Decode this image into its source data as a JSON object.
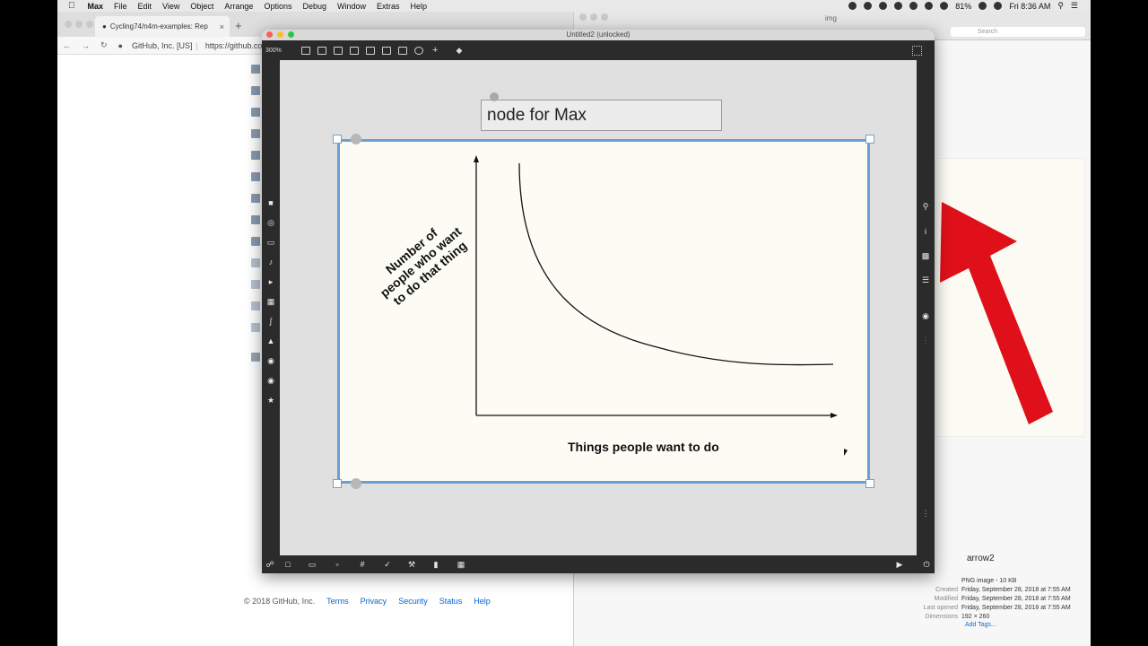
{
  "menubar": {
    "app": "Max",
    "items": [
      "File",
      "Edit",
      "View",
      "Object",
      "Arrange",
      "Options",
      "Debug",
      "Window",
      "Extras",
      "Help"
    ],
    "battery": "81%",
    "clock": "Fri 8:36 AM"
  },
  "browser": {
    "tab_title": "Cycling74/n4m-examples: Rep",
    "site_name": "GitHub, Inc. [US]",
    "url": "https://github.co",
    "footer": {
      "copyright": "© 2018 GitHub, Inc.",
      "links": [
        "Terms",
        "Privacy",
        "Security",
        "Status",
        "Help"
      ]
    }
  },
  "finder": {
    "folder": "img",
    "search_placeholder": "Search",
    "file_name": "arrow2",
    "file_kind": "PNG image - 10 KB",
    "meta": [
      {
        "k": "Created",
        "v": "Friday, September 28, 2018 at 7:55 AM"
      },
      {
        "k": "Modified",
        "v": "Friday, September 28, 2018 at 7:55 AM"
      },
      {
        "k": "Last opened",
        "v": "Friday, September 28, 2018 at 7:55 AM"
      },
      {
        "k": "Dimensions",
        "v": "192 × 260"
      }
    ],
    "add_tags": "Add Tags..."
  },
  "max": {
    "title": "Untitled2 (unlocked)",
    "zoom": "300%",
    "comment": "node for Max",
    "graph": {
      "ylabel_lines": [
        "Number of",
        "people who want",
        "to do that thing"
      ],
      "xlabel": "Things people want to do"
    }
  }
}
